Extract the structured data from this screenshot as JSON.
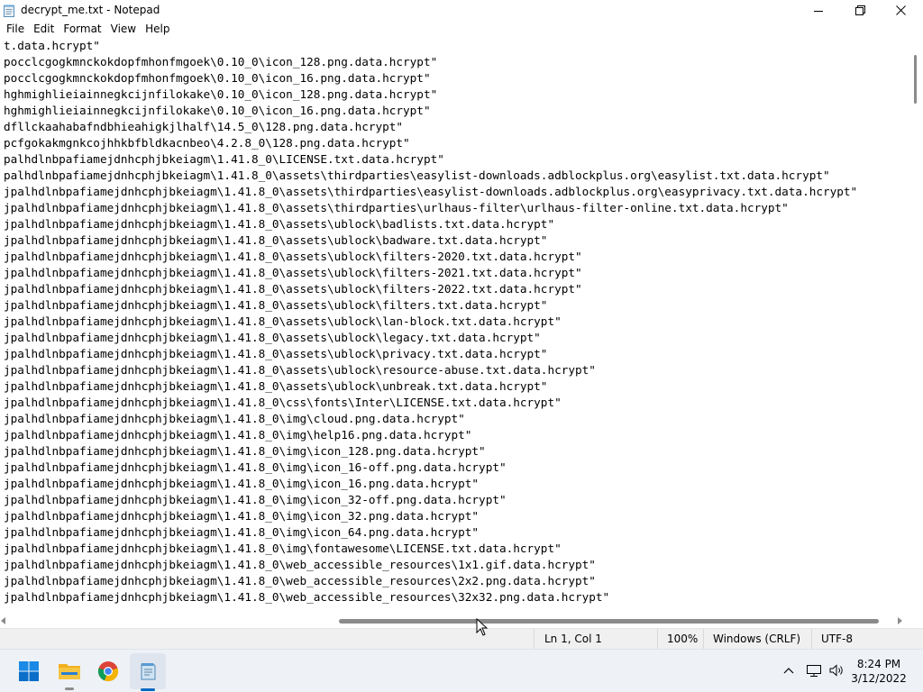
{
  "window": {
    "title": "decrypt_me.txt - Notepad",
    "controls": {
      "minimize": "minimize",
      "maximize": "maximize",
      "close": "close"
    }
  },
  "menu": [
    "File",
    "Edit",
    "Format",
    "View",
    "Help"
  ],
  "editor": {
    "lines": [
      "t.data.hcrypt\"",
      "pocclcgogkmnckokdopfmhonfmgoek\\0.10_0\\icon_128.png.data.hcrypt\"",
      "pocclcgogkmnckokdopfmhonfmgoek\\0.10_0\\icon_16.png.data.hcrypt\"",
      "hghmighlieiainnegkcijnfilokake\\0.10_0\\icon_128.png.data.hcrypt\"",
      "hghmighlieiainnegkcijnfilokake\\0.10_0\\icon_16.png.data.hcrypt\"",
      "dfllckaahabafndbhieahigkjlhalf\\14.5_0\\128.png.data.hcrypt\"",
      "pcfgokakmgnkcojhhkbfbldkacnbeo\\4.2.8_0\\128.png.data.hcrypt\"",
      "palhdlnbpafiamejdnhcphjbkeiagm\\1.41.8_0\\LICENSE.txt.data.hcrypt\"",
      "palhdlnbpafiamejdnhcphjbkeiagm\\1.41.8_0\\assets\\thirdparties\\easylist-downloads.adblockplus.org\\easylist.txt.data.hcrypt\"",
      "jpalhdlnbpafiamejdnhcphjbkeiagm\\1.41.8_0\\assets\\thirdparties\\easylist-downloads.adblockplus.org\\easyprivacy.txt.data.hcrypt\"",
      "jpalhdlnbpafiamejdnhcphjbkeiagm\\1.41.8_0\\assets\\thirdparties\\urlhaus-filter\\urlhaus-filter-online.txt.data.hcrypt\"",
      "jpalhdlnbpafiamejdnhcphjbkeiagm\\1.41.8_0\\assets\\ublock\\badlists.txt.data.hcrypt\"",
      "jpalhdlnbpafiamejdnhcphjbkeiagm\\1.41.8_0\\assets\\ublock\\badware.txt.data.hcrypt\"",
      "jpalhdlnbpafiamejdnhcphjbkeiagm\\1.41.8_0\\assets\\ublock\\filters-2020.txt.data.hcrypt\"",
      "jpalhdlnbpafiamejdnhcphjbkeiagm\\1.41.8_0\\assets\\ublock\\filters-2021.txt.data.hcrypt\"",
      "jpalhdlnbpafiamejdnhcphjbkeiagm\\1.41.8_0\\assets\\ublock\\filters-2022.txt.data.hcrypt\"",
      "jpalhdlnbpafiamejdnhcphjbkeiagm\\1.41.8_0\\assets\\ublock\\filters.txt.data.hcrypt\"",
      "jpalhdlnbpafiamejdnhcphjbkeiagm\\1.41.8_0\\assets\\ublock\\lan-block.txt.data.hcrypt\"",
      "jpalhdlnbpafiamejdnhcphjbkeiagm\\1.41.8_0\\assets\\ublock\\legacy.txt.data.hcrypt\"",
      "jpalhdlnbpafiamejdnhcphjbkeiagm\\1.41.8_0\\assets\\ublock\\privacy.txt.data.hcrypt\"",
      "jpalhdlnbpafiamejdnhcphjbkeiagm\\1.41.8_0\\assets\\ublock\\resource-abuse.txt.data.hcrypt\"",
      "jpalhdlnbpafiamejdnhcphjbkeiagm\\1.41.8_0\\assets\\ublock\\unbreak.txt.data.hcrypt\"",
      "jpalhdlnbpafiamejdnhcphjbkeiagm\\1.41.8_0\\css\\fonts\\Inter\\LICENSE.txt.data.hcrypt\"",
      "jpalhdlnbpafiamejdnhcphjbkeiagm\\1.41.8_0\\img\\cloud.png.data.hcrypt\"",
      "jpalhdlnbpafiamejdnhcphjbkeiagm\\1.41.8_0\\img\\help16.png.data.hcrypt\"",
      "jpalhdlnbpafiamejdnhcphjbkeiagm\\1.41.8_0\\img\\icon_128.png.data.hcrypt\"",
      "jpalhdlnbpafiamejdnhcphjbkeiagm\\1.41.8_0\\img\\icon_16-off.png.data.hcrypt\"",
      "jpalhdlnbpafiamejdnhcphjbkeiagm\\1.41.8_0\\img\\icon_16.png.data.hcrypt\"",
      "jpalhdlnbpafiamejdnhcphjbkeiagm\\1.41.8_0\\img\\icon_32-off.png.data.hcrypt\"",
      "jpalhdlnbpafiamejdnhcphjbkeiagm\\1.41.8_0\\img\\icon_32.png.data.hcrypt\"",
      "jpalhdlnbpafiamejdnhcphjbkeiagm\\1.41.8_0\\img\\icon_64.png.data.hcrypt\"",
      "jpalhdlnbpafiamejdnhcphjbkeiagm\\1.41.8_0\\img\\fontawesome\\LICENSE.txt.data.hcrypt\"",
      "jpalhdlnbpafiamejdnhcphjbkeiagm\\1.41.8_0\\web_accessible_resources\\1x1.gif.data.hcrypt\"",
      "jpalhdlnbpafiamejdnhcphjbkeiagm\\1.41.8_0\\web_accessible_resources\\2x2.png.data.hcrypt\"",
      "jpalhdlnbpafiamejdnhcphjbkeiagm\\1.41.8_0\\web_accessible_resources\\32x32.png.data.hcrypt\""
    ]
  },
  "status": {
    "position": "Ln 1, Col 1",
    "zoom": "100%",
    "line_ending": "Windows (CRLF)",
    "encoding": "UTF-8"
  },
  "taskbar": {
    "pinned": [
      "start-icon",
      "file-explorer-icon",
      "chrome-icon",
      "notepad-icon"
    ],
    "tray": [
      "chevron-up-icon",
      "network-icon",
      "volume-icon"
    ],
    "time": "8:24 PM",
    "date": "3/12/2022"
  },
  "colors": {
    "taskbar": "#eef2f7",
    "status_bar": "#f0f0f0",
    "start_blue": "#0078d4",
    "explorer_yellow": "#f5c542"
  }
}
